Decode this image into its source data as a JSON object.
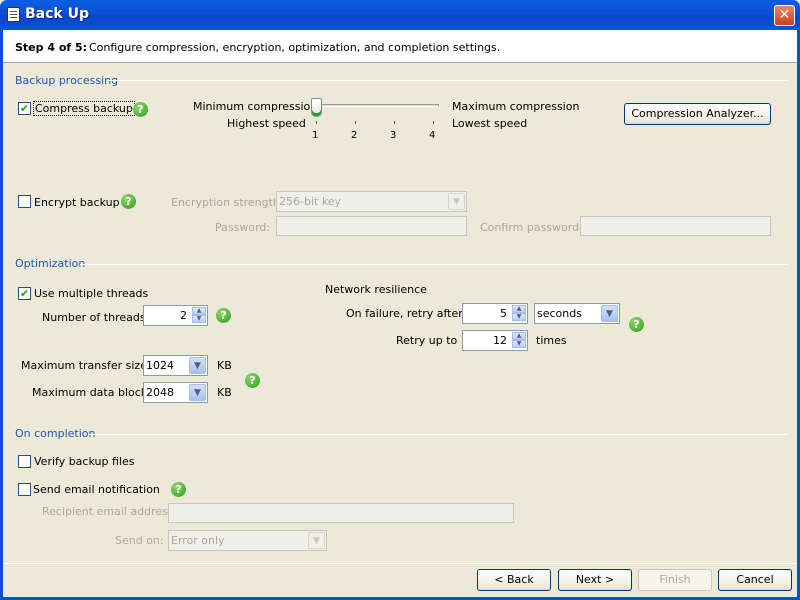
{
  "window": {
    "title": "Back Up",
    "close_icon": "close-icon"
  },
  "step": {
    "label": "Step 4 of 5:",
    "description": "Configure compression, encryption, optimization, and completion settings."
  },
  "backup_processing": {
    "title": "Backup processing",
    "compress_label": "Compress backup",
    "compress_checked": true,
    "min_compression": "Minimum compression",
    "highest_speed": "Highest speed",
    "max_compression": "Maximum compression",
    "lowest_speed": "Lowest speed",
    "slider_ticks": [
      "1",
      "2",
      "3",
      "4"
    ],
    "slider_value": 1,
    "analyzer_button": "Compression Analyzer...",
    "encrypt_label": "Encrypt backup",
    "encrypt_checked": false,
    "strength_label": "Encryption strength:",
    "strength_value": "256-bit key",
    "password_label": "Password:",
    "confirm_label": "Confirm password:"
  },
  "optimization": {
    "title": "Optimization",
    "threads_label": "Use multiple threads",
    "threads_checked": true,
    "num_threads_label": "Number of threads:",
    "num_threads_value": "2",
    "max_transfer_label": "Maximum transfer size:",
    "max_transfer_value": "1024",
    "max_transfer_unit": "KB",
    "max_block_label": "Maximum data block:",
    "max_block_value": "2048",
    "max_block_unit": "KB",
    "network_title": "Network resilience",
    "retry_after_label": "On failure, retry after",
    "retry_after_value": "5",
    "retry_after_unit": "seconds",
    "retry_up_to_label": "Retry up to",
    "retry_up_to_value": "12",
    "retry_up_to_unit": "times"
  },
  "completion": {
    "title": "On completion",
    "verify_label": "Verify backup files",
    "verify_checked": false,
    "email_label": "Send email notification",
    "email_checked": false,
    "recipient_label": "Recipient email address:",
    "send_on_label": "Send on:",
    "send_on_value": "Error only"
  },
  "footer": {
    "back": "< Back",
    "next": "Next >",
    "finish": "Finish",
    "cancel": "Cancel"
  },
  "help_icon": "?",
  "colors": {
    "accent": "#0b4fd4",
    "section_title": "#1f5ab0",
    "check": "#21a121"
  }
}
